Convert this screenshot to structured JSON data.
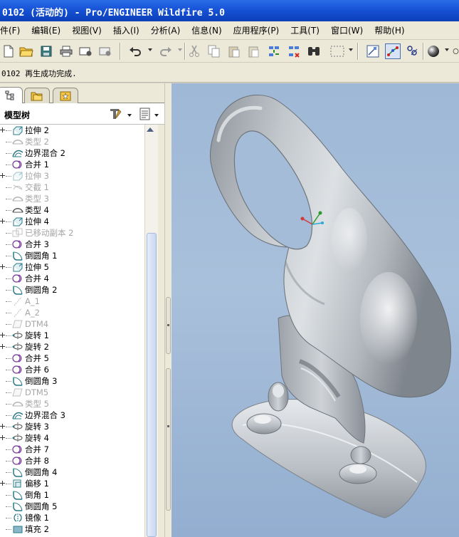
{
  "window": {
    "title": "0102 (活动的) - Pro/ENGINEER Wildfire 5.0"
  },
  "menu": {
    "items": [
      "件(F)",
      "编辑(E)",
      "视图(V)",
      "插入(I)",
      "分析(A)",
      "信息(N)",
      "应用程序(P)",
      "工具(T)",
      "窗口(W)",
      "帮助(H)"
    ]
  },
  "toolbar": {
    "icons": [
      "new-file-icon",
      "open-folder-icon",
      "save-icon",
      "print-icon",
      "email-icon",
      "close-window-icon",
      "undo-icon",
      "redo-icon",
      "cut-icon",
      "copy-icon",
      "paste-icon",
      "paste-special-icon",
      "regenerate-icon",
      "regenerate-manager-icon",
      "find-icon",
      "select-box-icon",
      "model-tree-toggle-icon",
      "datum-axis-display-icon",
      "point-display-icon",
      "shading-icon"
    ]
  },
  "message": {
    "text": "0102 再生成功完成."
  },
  "model_tree": {
    "title": "模型树",
    "tools": [
      "settings-icon",
      "show-icon"
    ],
    "items": [
      {
        "label": "拉伸 2",
        "icon": "extrude-icon",
        "expand": true,
        "dim": false
      },
      {
        "label": "类型 2",
        "icon": "type-icon",
        "expand": false,
        "dim": true
      },
      {
        "label": "边界混合 2",
        "icon": "boundary-blend-icon",
        "expand": false,
        "dim": false
      },
      {
        "label": "合并 1",
        "icon": "merge-icon",
        "expand": false,
        "dim": false
      },
      {
        "label": "拉伸 3",
        "icon": "extrude-icon",
        "expand": true,
        "dim": true
      },
      {
        "label": "交截 1",
        "icon": "intersect-icon",
        "expand": false,
        "dim": true
      },
      {
        "label": "类型 3",
        "icon": "type-icon",
        "expand": false,
        "dim": true
      },
      {
        "label": "类型 4",
        "icon": "type-icon",
        "expand": false,
        "dim": false
      },
      {
        "label": "拉伸 4",
        "icon": "extrude-icon",
        "expand": true,
        "dim": false
      },
      {
        "label": "已移动副本 2",
        "icon": "moved-copy-icon",
        "expand": false,
        "dim": true
      },
      {
        "label": "合并 3",
        "icon": "merge-icon",
        "expand": false,
        "dim": false
      },
      {
        "label": "倒圆角 1",
        "icon": "round-icon",
        "expand": false,
        "dim": false
      },
      {
        "label": "拉伸 5",
        "icon": "extrude-icon",
        "expand": true,
        "dim": false
      },
      {
        "label": "合并 4",
        "icon": "merge-icon",
        "expand": false,
        "dim": false
      },
      {
        "label": "倒圆角 2",
        "icon": "round-icon",
        "expand": false,
        "dim": false
      },
      {
        "label": "A_1",
        "icon": "axis-icon",
        "expand": false,
        "dim": true
      },
      {
        "label": "A_2",
        "icon": "axis-icon",
        "expand": false,
        "dim": true
      },
      {
        "label": "DTM4",
        "icon": "datum-plane-icon",
        "expand": false,
        "dim": true
      },
      {
        "label": "旋转 1",
        "icon": "revolve-icon",
        "expand": true,
        "dim": false
      },
      {
        "label": "旋转 2",
        "icon": "revolve-icon",
        "expand": true,
        "dim": false
      },
      {
        "label": "合并 5",
        "icon": "merge-icon",
        "expand": false,
        "dim": false
      },
      {
        "label": "合并 6",
        "icon": "merge-icon",
        "expand": false,
        "dim": false
      },
      {
        "label": "倒圆角 3",
        "icon": "round-icon",
        "expand": false,
        "dim": false
      },
      {
        "label": "DTM5",
        "icon": "datum-plane-icon",
        "expand": false,
        "dim": true
      },
      {
        "label": "类型 5",
        "icon": "type-icon",
        "expand": false,
        "dim": true
      },
      {
        "label": "边界混合 3",
        "icon": "boundary-blend-icon",
        "expand": false,
        "dim": false
      },
      {
        "label": "旋转 3",
        "icon": "revolve-icon",
        "expand": true,
        "dim": false
      },
      {
        "label": "旋转 4",
        "icon": "revolve-icon",
        "expand": true,
        "dim": false
      },
      {
        "label": "合并 7",
        "icon": "merge-icon",
        "expand": false,
        "dim": false
      },
      {
        "label": "合并 8",
        "icon": "merge-icon",
        "expand": false,
        "dim": false
      },
      {
        "label": "倒圆角 4",
        "icon": "round-icon",
        "expand": false,
        "dim": false
      },
      {
        "label": "偏移 1",
        "icon": "offset-icon",
        "expand": true,
        "dim": false
      },
      {
        "label": "倒角 1",
        "icon": "round-icon",
        "expand": false,
        "dim": false
      },
      {
        "label": "倒圆角 5",
        "icon": "round-icon",
        "expand": false,
        "dim": false
      },
      {
        "label": "镜像 1",
        "icon": "mirror-icon",
        "expand": false,
        "dim": false
      },
      {
        "label": "填充 2",
        "icon": "fill-icon",
        "expand": false,
        "dim": false
      }
    ]
  },
  "colors": {
    "title_bar": "#1753d6",
    "viewport_bg": "#9eb8d6",
    "model_surface": "#c5cacf",
    "feature_icon": "#7a3b9a",
    "disabled_text": "#a6a6a6"
  }
}
